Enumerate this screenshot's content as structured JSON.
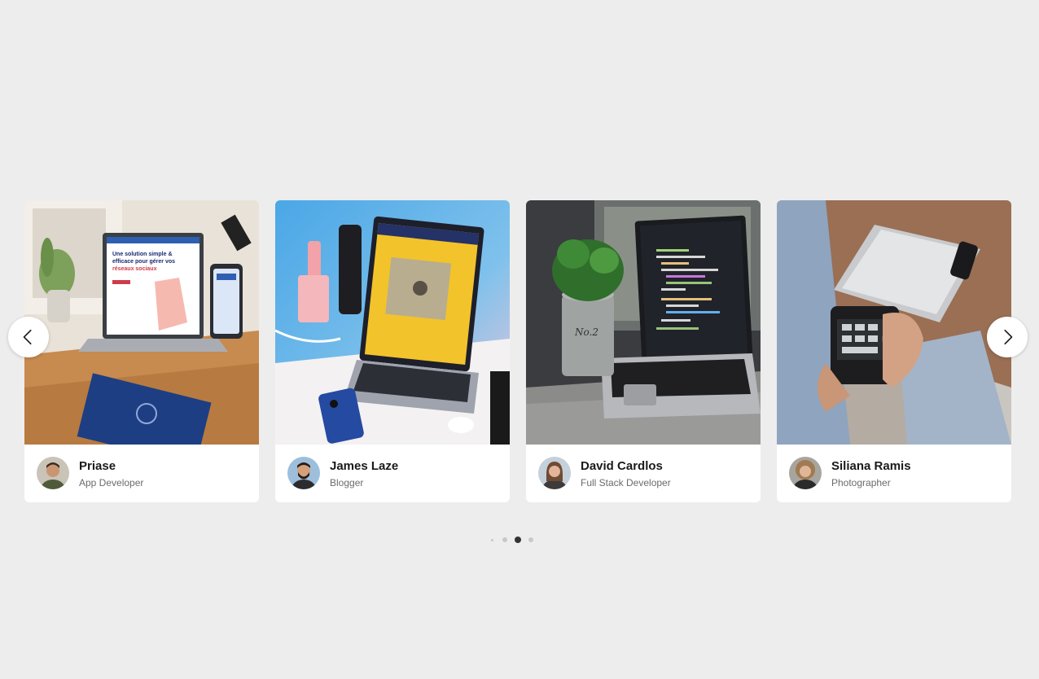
{
  "carousel": {
    "cards": [
      {
        "photo": "laptop-on-wooden-desk-photo",
        "avatar": "man-avatar-photo",
        "name": "Priase",
        "role": "App Developer"
      },
      {
        "photo": "laptop-yellow-screen-photo",
        "avatar": "bearded-man-avatar-photo",
        "name": "James Laze",
        "role": "Blogger"
      },
      {
        "photo": "laptop-code-editor-photo",
        "avatar": "woman-avatar-photo",
        "name": "David Cardlos",
        "role": "Full Stack Developer"
      },
      {
        "photo": "camera-in-hands-photo",
        "avatar": "woman-curly-hair-avatar-photo",
        "name": "Siliana Ramis",
        "role": "Photographer"
      }
    ],
    "prev_icon": "chevron-left-icon",
    "next_icon": "chevron-right-icon",
    "pagination": {
      "count": 4,
      "active_index": 2
    },
    "colors": {
      "background": "#ededed",
      "card": "#ffffff",
      "dot_active": "#333333",
      "dot_inactive": "#c8c8c8"
    }
  }
}
